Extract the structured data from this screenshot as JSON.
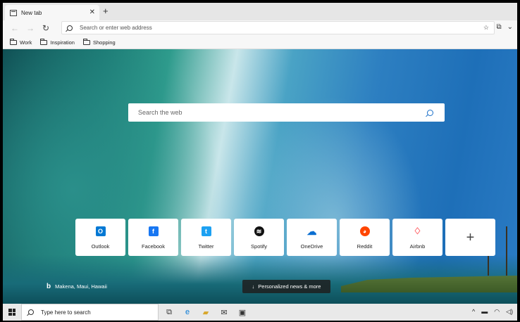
{
  "browser": {
    "tab_title": "New tab",
    "tab_close": "✕",
    "new_tab": "+",
    "address_placeholder": "Search or enter web address",
    "bookmarks": [
      {
        "label": "Work"
      },
      {
        "label": "Inspiration"
      },
      {
        "label": "Shopping"
      }
    ]
  },
  "newtab": {
    "search_placeholder": "Search the web",
    "tiles": [
      {
        "label": "Outlook",
        "icon": "outlook-icon",
        "color": "#0078d4"
      },
      {
        "label": "Facebook",
        "icon": "facebook-icon",
        "color": "#1877f2"
      },
      {
        "label": "Twitter",
        "icon": "twitter-icon",
        "color": "#1da1f2"
      },
      {
        "label": "Spotify",
        "icon": "spotify-icon",
        "color": "#111111"
      },
      {
        "label": "OneDrive",
        "icon": "onedrive-icon",
        "color": "#0a6ed1"
      },
      {
        "label": "Reddit",
        "icon": "reddit-icon",
        "color": "#ff4500"
      },
      {
        "label": "Airbnb",
        "icon": "airbnb-icon",
        "color": "#ff5a5f"
      }
    ],
    "add_tile": "+",
    "location": "Makena, Maui, Hawaii",
    "news_button": "Personalized news & more"
  },
  "taskbar": {
    "search_placeholder": "Type here to search",
    "apps": [
      "task-view-icon",
      "edge-icon",
      "file-explorer-icon",
      "mail-icon",
      "store-icon"
    ]
  }
}
